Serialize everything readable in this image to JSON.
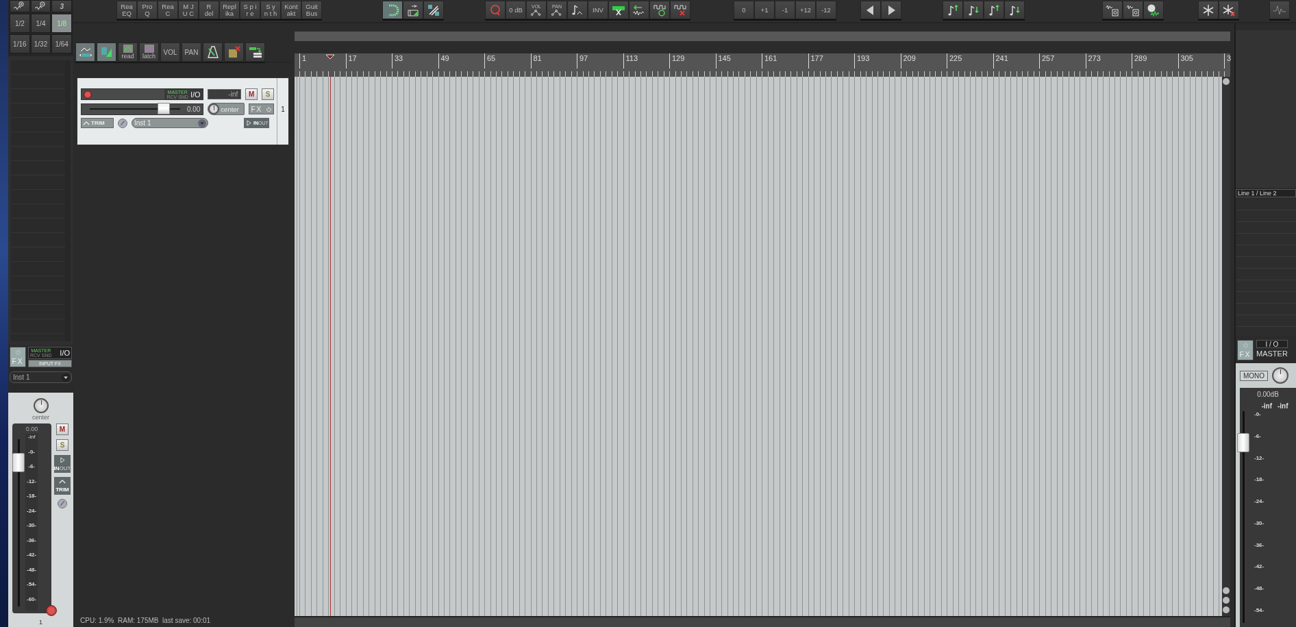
{
  "grid_panel": {
    "triplet_label": "3",
    "buttons": [
      {
        "label": "1/2",
        "selected": false
      },
      {
        "label": "1/4",
        "selected": false
      },
      {
        "label": "1/8",
        "selected": true
      },
      {
        "label": "1/16",
        "selected": false
      },
      {
        "label": "1/32",
        "selected": false
      },
      {
        "label": "1/64",
        "selected": false
      }
    ]
  },
  "fx_buttons": [
    {
      "lines": [
        "Rea",
        "EQ"
      ]
    },
    {
      "lines": [
        "Pro",
        "Q"
      ]
    },
    {
      "lines": [
        "Rea",
        "C"
      ]
    },
    {
      "lines": [
        "M J",
        "U C"
      ]
    },
    {
      "lines": [
        "R",
        "del"
      ]
    },
    {
      "lines": [
        "Repl",
        "ika"
      ]
    },
    {
      "lines": [
        "S p i",
        "r e"
      ]
    },
    {
      "lines": [
        "S y",
        "n t h"
      ]
    },
    {
      "lines": [
        "Kont",
        "akt"
      ]
    },
    {
      "lines": [
        "Guit",
        "Bus"
      ]
    }
  ],
  "snap": {
    "on": true
  },
  "edit_tools": {
    "gain_label": "0 dB",
    "vol_label": "VOL",
    "pan_label": "PAN",
    "invert_label": "INV"
  },
  "transpose": [
    "0",
    "+1",
    "-1",
    "+12",
    "-12"
  ],
  "envelope_toolbar": [
    {
      "kind": "points",
      "on": true
    },
    {
      "kind": "trim",
      "on": true
    },
    {
      "kind": "mode",
      "label": "read",
      "on": false
    },
    {
      "kind": "mode",
      "label": "latch",
      "on": false
    },
    {
      "kind": "text",
      "label": "VOL",
      "on": false
    },
    {
      "kind": "text",
      "label": "PAN",
      "on": false
    },
    {
      "kind": "metronome",
      "on": false
    },
    {
      "kind": "solo-clear",
      "on": false
    },
    {
      "kind": "route",
      "on": false
    }
  ],
  "ruler": {
    "marks": [
      "1",
      "17",
      "33",
      "49",
      "65",
      "81",
      "97",
      "113",
      "129",
      "145",
      "161",
      "177",
      "193",
      "209",
      "225",
      "241",
      "257",
      "273",
      "289",
      "305",
      "3"
    ]
  },
  "track": {
    "routing_top": "MASTER",
    "routing_bottom": "RCV SND",
    "io": "I/O",
    "meter": "-inf",
    "mute": "M",
    "solo": "S",
    "volume": "0.00",
    "level": 0.82,
    "pan": "center",
    "fx": "FX",
    "trim": "TRIM",
    "name": "Inst 1",
    "in": "IN",
    "out": "OUT",
    "number": "1"
  },
  "mixer_strip": {
    "fx": "FX",
    "routing_top": "MASTER",
    "routing_bottom": "RCV SND",
    "io": "I/O",
    "input_fx": "INPUT FX",
    "name": "Inst 1",
    "pan": "center",
    "volume": "0.00",
    "peak": "-inf",
    "level": 0.86,
    "scale": [
      "-0-",
      "-6-",
      "-12-",
      "-18-",
      "-24-",
      "-30-",
      "-36-",
      "-42-",
      "-48-",
      "-54-",
      "-60-"
    ],
    "mute": "M",
    "solo": "S",
    "in": "IN",
    "out": "OUT",
    "trim": "TRIM",
    "number": "1"
  },
  "master": {
    "input": "Line 1 / Line 2",
    "fx": "FX",
    "io": "I / O",
    "name": "MASTER",
    "mono": "MONO",
    "volume": "0.00dB",
    "peaks": [
      "-inf",
      "-inf"
    ],
    "level": 0.85,
    "scale": [
      "-0-",
      "-6-",
      "-12-",
      "-18-",
      "-24-",
      "-30-",
      "-36-",
      "-42-",
      "-48-",
      "-54-"
    ]
  },
  "status_bar": {
    "text": "CPU: 1.9%  RAM: 175MB  last save: 00:01"
  }
}
